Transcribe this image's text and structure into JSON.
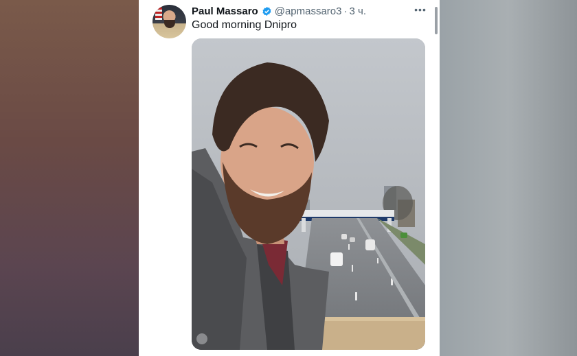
{
  "tweet": {
    "author_name": "Paul Massaro",
    "handle": "@apmassaro3",
    "separator": "·",
    "time": "3 ч.",
    "text": "Good morning Dnipro",
    "more_label": "•••"
  },
  "icons": {
    "verified": "verified-badge-icon",
    "more": "more-options-icon"
  },
  "colors": {
    "verified": "#1d9bf0",
    "name": "#0f1419",
    "secondary": "#536471"
  }
}
